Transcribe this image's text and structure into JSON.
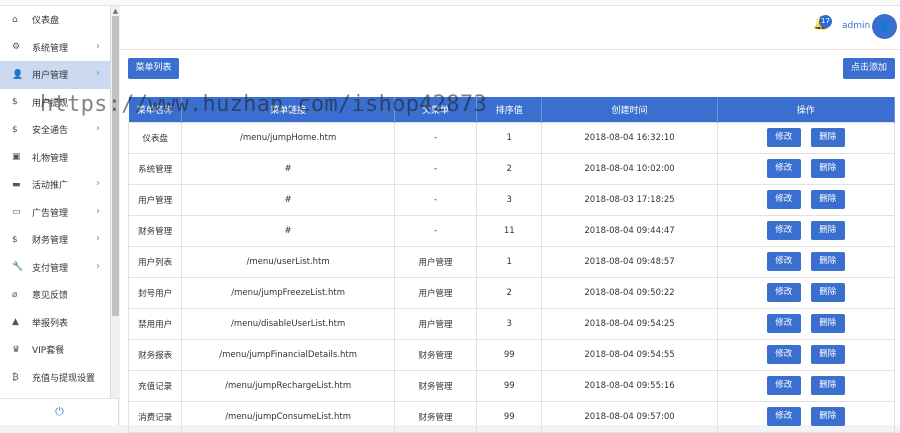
{
  "colors": {
    "primary": "#3b6fcf",
    "sidebar_active": "#cbdaf1"
  },
  "sidebar": {
    "items": [
      {
        "icon": "home-icon",
        "glyph": "⌂",
        "label": "仪表盘",
        "arrow": false,
        "active": false
      },
      {
        "icon": "cogs-icon",
        "glyph": "⚙",
        "label": "系统管理",
        "arrow": true,
        "active": false
      },
      {
        "icon": "user-icon",
        "glyph": "👤",
        "label": "用户管理",
        "arrow": true,
        "active": true
      },
      {
        "icon": "dollar-icon",
        "glyph": "$",
        "label": "用户提现",
        "arrow": false,
        "active": false
      },
      {
        "icon": "dollar-icon",
        "glyph": "$",
        "label": "安全通告",
        "arrow": true,
        "active": false
      },
      {
        "icon": "gift-icon",
        "glyph": "▣",
        "label": "礼物管理",
        "arrow": false,
        "active": false
      },
      {
        "icon": "folder-icon",
        "glyph": "▬",
        "label": "活动推广",
        "arrow": true,
        "active": false
      },
      {
        "icon": "monitor-icon",
        "glyph": "▭",
        "label": "广告管理",
        "arrow": true,
        "active": false
      },
      {
        "icon": "dollar-icon",
        "glyph": "$",
        "label": "财务管理",
        "arrow": true,
        "active": false
      },
      {
        "icon": "wrench-icon",
        "glyph": "🔧",
        "label": "支付管理",
        "arrow": true,
        "active": false
      },
      {
        "icon": "paperclip-icon",
        "glyph": "⌀",
        "label": "意见反馈",
        "arrow": false,
        "active": false
      },
      {
        "icon": "warning-icon",
        "glyph": "▲",
        "label": "举报列表",
        "arrow": false,
        "active": false
      },
      {
        "icon": "vip-icon",
        "glyph": "♛",
        "label": "VIP套餐",
        "arrow": false,
        "active": false
      },
      {
        "icon": "bitcoin-icon",
        "glyph": "₿",
        "label": "充值与提现设置",
        "arrow": false,
        "active": false
      }
    ],
    "power_glyph": "⏻"
  },
  "header": {
    "notification_count": "17",
    "username": "admin",
    "avatar_glyph": "👤"
  },
  "toolbar": {
    "menu_list_label": "菜单列表",
    "add_label": "点击添加"
  },
  "watermark": "https://www.huzhan.com/ishop42873",
  "table": {
    "columns": [
      "菜单名称",
      "菜单链接",
      "父菜单",
      "排序值",
      "创建时间",
      "操作"
    ],
    "edit_label": "修改",
    "delete_label": "删除",
    "rows": [
      {
        "name": "仪表盘",
        "url": "/menu/jumpHome.htm",
        "parent": "-",
        "order": "1",
        "created": "2018-08-04 16:32:10"
      },
      {
        "name": "系统管理",
        "url": "#",
        "parent": "-",
        "order": "2",
        "created": "2018-08-04 10:02:00"
      },
      {
        "name": "用户管理",
        "url": "#",
        "parent": "-",
        "order": "3",
        "created": "2018-08-03 17:18:25"
      },
      {
        "name": "财务管理",
        "url": "#",
        "parent": "-",
        "order": "11",
        "created": "2018-08-04 09:44:47"
      },
      {
        "name": "用户列表",
        "url": "/menu/userList.htm",
        "parent": "用户管理",
        "order": "1",
        "created": "2018-08-04 09:48:57"
      },
      {
        "name": "封号用户",
        "url": "/menu/jumpFreezeList.htm",
        "parent": "用户管理",
        "order": "2",
        "created": "2018-08-04 09:50:22"
      },
      {
        "name": "禁用用户",
        "url": "/menu/disableUserList.htm",
        "parent": "用户管理",
        "order": "3",
        "created": "2018-08-04 09:54:25"
      },
      {
        "name": "财务报表",
        "url": "/menu/jumpFinancialDetails.htm",
        "parent": "财务管理",
        "order": "99",
        "created": "2018-08-04 09:54:55"
      },
      {
        "name": "充值记录",
        "url": "/menu/jumpRechargeList.htm",
        "parent": "财务管理",
        "order": "99",
        "created": "2018-08-04 09:55:16"
      },
      {
        "name": "消费记录",
        "url": "/menu/jumpConsumeList.htm",
        "parent": "财务管理",
        "order": "99",
        "created": "2018-08-04 09:57:00"
      }
    ]
  }
}
